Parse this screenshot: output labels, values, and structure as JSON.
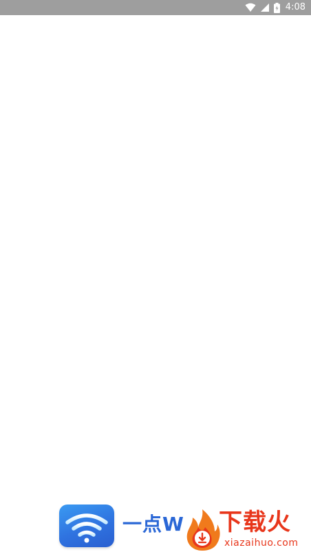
{
  "status_bar": {
    "time": "4:08",
    "icons": [
      "wifi-icon",
      "cell-signal-icon",
      "battery-icon"
    ],
    "background": "#9e9e9e"
  },
  "splash": {
    "app_icon": "wifi-icon",
    "app_name": "一点W",
    "background": "#ffffff",
    "brand_color": "#2a67d6"
  },
  "watermark": {
    "title": "下载火",
    "url": "xiazaihuo.com",
    "color": "#e8361b"
  }
}
